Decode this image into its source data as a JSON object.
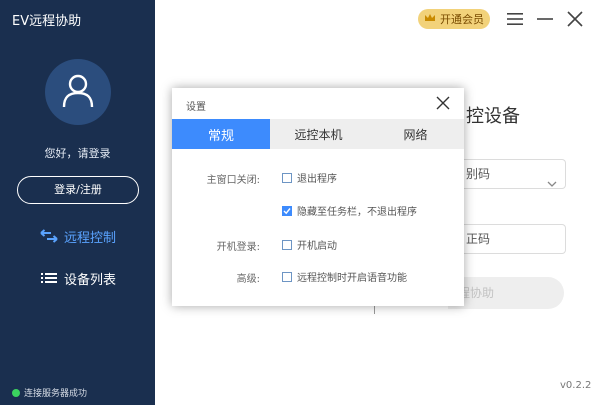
{
  "app": {
    "title": "EV远程协助"
  },
  "sidebar": {
    "greeting": "您好，请登录",
    "login_label": "登录/注册",
    "nav": [
      {
        "label": "远程控制",
        "icon": "swap-arrows-icon",
        "active": true
      },
      {
        "label": "设备列表",
        "icon": "list-icon",
        "active": false
      }
    ],
    "status_text": "连接服务器成功",
    "status_color": "#3bd45f"
  },
  "topbar": {
    "vip_label": "开通会员",
    "icons": [
      "crown-icon",
      "menu-icon",
      "minimize-icon",
      "close-icon"
    ]
  },
  "main_bg": {
    "heading_fragment": "控设备",
    "field1_fragment": "别码",
    "field2_fragment": "正码",
    "action_fragment": "程协助",
    "version": "v0.2.2"
  },
  "dialog": {
    "title": "设置",
    "tabs": [
      {
        "label": "常规",
        "active": true
      },
      {
        "label": "远控本机",
        "active": false
      },
      {
        "label": "网络",
        "active": false
      }
    ],
    "rows": {
      "close_label": "主窗口关闭:",
      "close_options": [
        {
          "label": "退出程序",
          "checked": false
        },
        {
          "label": "隐藏至任务栏，不退出程序",
          "checked": true
        }
      ],
      "startup_label": "开机登录:",
      "startup_option": {
        "label": "开机启动",
        "checked": false
      },
      "advanced_label": "高级:",
      "advanced_option": {
        "label": "远程控制时开启语音功能",
        "checked": false
      }
    }
  },
  "colors": {
    "sidebar_bg": "#1a2f4f",
    "accent": "#3d8bfd",
    "nav_active": "#5aa3ff",
    "vip_bg": "#f2d27a"
  }
}
